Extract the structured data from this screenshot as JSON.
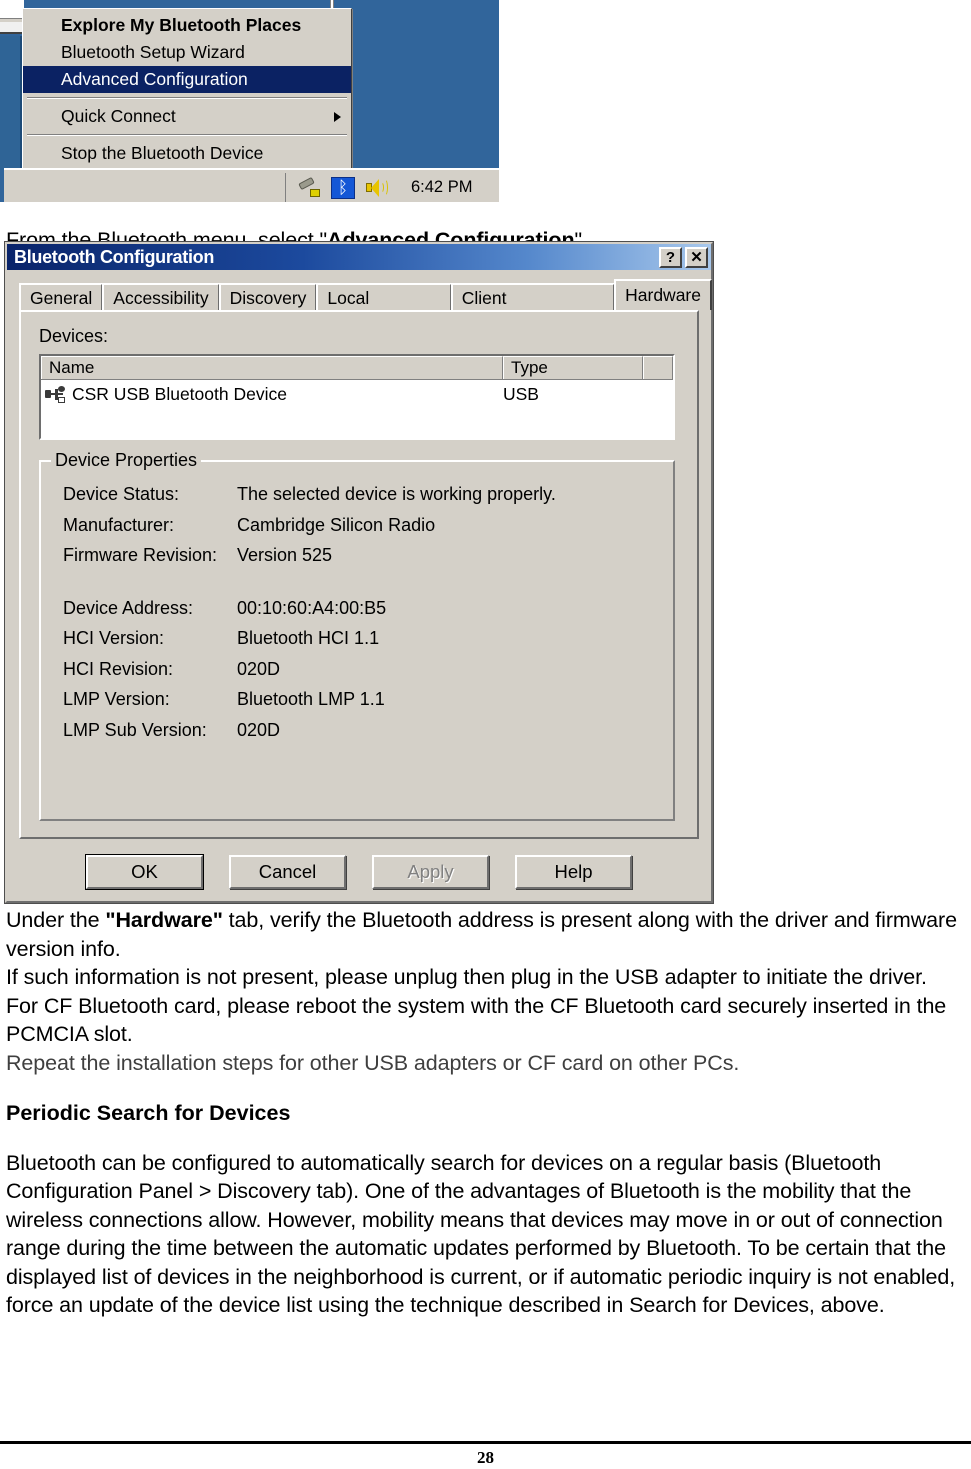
{
  "tray_screenshot": {
    "menu": {
      "items": [
        {
          "label": "Explore My Bluetooth Places",
          "bold": true,
          "selected": false,
          "submenu": false
        },
        {
          "label": "Bluetooth Setup Wizard",
          "bold": false,
          "selected": false,
          "submenu": false
        },
        {
          "label": "Advanced Configuration",
          "bold": false,
          "selected": true,
          "submenu": false
        },
        {
          "label": "Quick Connect",
          "bold": false,
          "selected": false,
          "submenu": true
        },
        {
          "label": "Stop the Bluetooth Device",
          "bold": false,
          "selected": false,
          "submenu": false
        }
      ]
    },
    "taskbar": {
      "clock": "6:42 PM",
      "tray_icons": [
        "cable-plug-icon",
        "bluetooth-icon",
        "volume-speaker-icon"
      ],
      "bluetooth_glyph": "ᛒ"
    },
    "desktop_color": "#31659b"
  },
  "caption_1": {
    "before": "From the Bluetooth menu, select \"",
    "bold": "Advanced Configuration",
    "after": "\"."
  },
  "dialog": {
    "title": "Bluetooth Configuration",
    "titlebar_buttons": [
      {
        "name": "help-button",
        "label": "?"
      },
      {
        "name": "close-button",
        "label": "✕"
      }
    ],
    "tabs": [
      {
        "label": "General",
        "active": false
      },
      {
        "label": "Accessibility",
        "active": false
      },
      {
        "label": "Discovery",
        "active": false
      },
      {
        "label": "Local Services",
        "active": false
      },
      {
        "label": "Client Applications",
        "active": false
      },
      {
        "label": "Hardware",
        "active": true
      }
    ],
    "devices_label": "Devices:",
    "device_list": {
      "columns": [
        "Name",
        "Type"
      ],
      "rows": [
        {
          "name": "CSR USB Bluetooth Device",
          "type": "USB",
          "icon": "usb-device-icon"
        }
      ]
    },
    "device_properties": {
      "legend": "Device Properties",
      "rows": [
        {
          "key": "Device Status:",
          "value": "The selected device is working properly."
        },
        {
          "key": "Manufacturer:",
          "value": "Cambridge Silicon Radio"
        },
        {
          "key": "Firmware Revision:",
          "value": "Version 525"
        },
        {
          "key": "",
          "value": "",
          "gap": true
        },
        {
          "key": "Device Address:",
          "value": "00:10:60:A4:00:B5"
        },
        {
          "key": "HCI Version:",
          "value": "Bluetooth HCI 1.1"
        },
        {
          "key": "HCI Revision:",
          "value": "020D"
        },
        {
          "key": "LMP Version:",
          "value": "Bluetooth LMP 1.1"
        },
        {
          "key": "LMP Sub Version:",
          "value": "020D"
        }
      ]
    },
    "buttons": [
      {
        "label": "OK",
        "state": "default"
      },
      {
        "label": "Cancel",
        "state": "normal"
      },
      {
        "label": "Apply",
        "state": "disabled"
      },
      {
        "label": "Help",
        "state": "normal"
      }
    ],
    "titlebar_gradient": [
      "#0a246a",
      "#a8c8ec"
    ]
  },
  "body": {
    "p1_a": "Under the ",
    "p1_b": "\"Hardware\"",
    "p1_c": " tab, verify the Bluetooth address is present along with the driver and firmware version info.",
    "p2": "If such information is not present, please unplug then plug in the USB adapter to initiate the driver.",
    "p3": "For CF Bluetooth card, please reboot the system with the CF Bluetooth card securely inserted in the PCMCIA slot.",
    "p4": "Repeat the installation steps for other USB adapters or CF card on other PCs.",
    "h1": "Periodic Search for Devices",
    "p5": "Bluetooth can be configured to automatically search for devices on a regular basis (Bluetooth Configuration Panel > Discovery tab). One of the advantages of Bluetooth is the mobility that the wireless connections allow. However, mobility means that devices may move in or out of connection range during the time between the automatic updates performed by Bluetooth. To be certain that the displayed list of devices in the neighborhood is current, or if automatic periodic inquiry is not enabled, force an update of the device list using the technique described in Search for Devices, above."
  },
  "footer": {
    "page_number": "28"
  }
}
